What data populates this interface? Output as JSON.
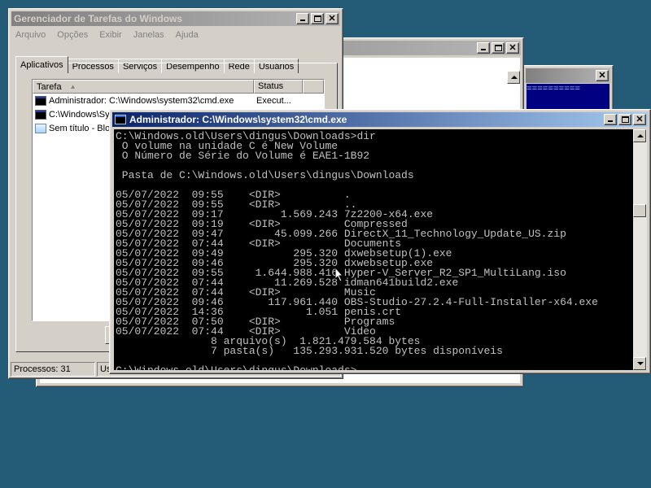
{
  "taskmanager": {
    "title": "Gerenciador de Tarefas do Windows",
    "menu": [
      "Arquivo",
      "Opções",
      "Exibir",
      "Janelas",
      "Ajuda"
    ],
    "tabs": [
      "Aplicativos",
      "Processos",
      "Serviços",
      "Desempenho",
      "Rede",
      "Usuários"
    ],
    "columns": {
      "task": "Tarefa",
      "status": "Status"
    },
    "rows": [
      {
        "task": "Administrador: C:\\Windows\\system32\\cmd.exe",
        "status": "Execut...",
        "icon": "cmd-icon"
      },
      {
        "task": "C:\\Windows\\Sy",
        "status": "",
        "icon": "cmd-icon"
      },
      {
        "task": "Sem título - Blo",
        "status": "",
        "icon": "notepad-icon"
      }
    ],
    "status": {
      "processes": "Processos: 31",
      "usage": "Us"
    }
  },
  "cmd": {
    "title": "Administrador: C:\\Windows\\system32\\cmd.exe",
    "lines": [
      "C:\\Windows.old\\Users\\dingus\\Downloads>dir",
      " O volume na unidade C é New Volume",
      " O Número de Série do Volume é EAE1-1B92",
      "",
      " Pasta de C:\\Windows.old\\Users\\dingus\\Downloads",
      "",
      "05/07/2022  09:55    <DIR>          .",
      "05/07/2022  09:55    <DIR>          ..",
      "05/07/2022  09:17         1.569.243 7z2200-x64.exe",
      "05/07/2022  09:19    <DIR>          Compressed",
      "05/07/2022  09:47        45.099.266 DirectX_11_Technology_Update_US.zip",
      "05/07/2022  07:44    <DIR>          Documents",
      "05/07/2022  09:49           295.320 dxwebsetup(1).exe",
      "05/07/2022  09:46           295.320 dxwebsetup.exe",
      "05/07/2022  09:55     1.644.988.416 Hyper-V_Server_R2_SP1_MultiLang.iso",
      "05/07/2022  07:44        11.269.528 idman641build2.exe",
      "05/07/2022  07:44    <DIR>          Music",
      "05/07/2022  09:46       117.961.440 OBS-Studio-27.2.4-Full-Installer-x64.exe",
      "05/07/2022  14:36             1.051 penis.crt",
      "05/07/2022  07:50    <DIR>          Programs",
      "05/07/2022  07:44    <DIR>          Video",
      "               8 arquivo(s)  1.821.479.584 bytes",
      "               7 pasta(s)   135.293.931.520 bytes disponíveis",
      "",
      "C:\\Windows.old\\Users\\dingus\\Downloads>"
    ]
  },
  "colors": {
    "desktop": "#245c78",
    "active_title": "#0a246a",
    "inactive_title": "#808080",
    "console_bg": "#000000",
    "console_fg": "#c0c0c0"
  }
}
